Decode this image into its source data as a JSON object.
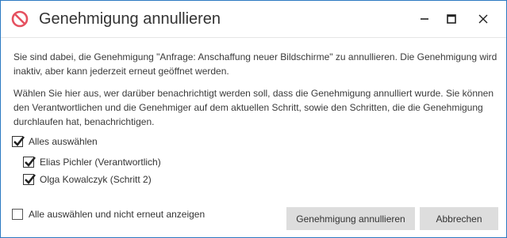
{
  "window": {
    "title": "Genehmigung annullieren",
    "icon": "prohibited-icon",
    "controls": [
      "minimize-icon",
      "maximize-icon",
      "close-icon"
    ]
  },
  "body": {
    "paragraph1": "Sie sind dabei, die Genehmigung \"Anfrage: Anschaffung neuer Bildschirme\" zu annullieren. Die Genehmigung wird inaktiv, aber kann jederzeit erneut geöffnet werden.",
    "paragraph2": "Wählen Sie hier aus, wer darüber benachrichtigt werden soll, dass die Genehmigung annulliert wurde. Sie können den Verantwortlichen und die Genehmiger auf dem aktuellen Schritt, sowie den Schritten, die die Genehmigung durchlaufen hat, benachrichtigen."
  },
  "recipients": {
    "select_all_label": "Alles auswählen",
    "select_all_checked": true,
    "people": [
      {
        "label": "Elias Pichler (Verantwortlich)",
        "checked": true
      },
      {
        "label": "Olga Kowalczyk (Schritt 2)",
        "checked": true
      }
    ]
  },
  "footer": {
    "dont_show_label": "Alle auswählen und nicht erneut anzeigen",
    "dont_show_checked": false,
    "annul_button": "Genehmigung annullieren",
    "cancel_button": "Abbrechen"
  },
  "colors": {
    "accent_border": "#2b79c2",
    "prohibited_icon": "#e5505f",
    "button_bg": "#dddddd"
  }
}
